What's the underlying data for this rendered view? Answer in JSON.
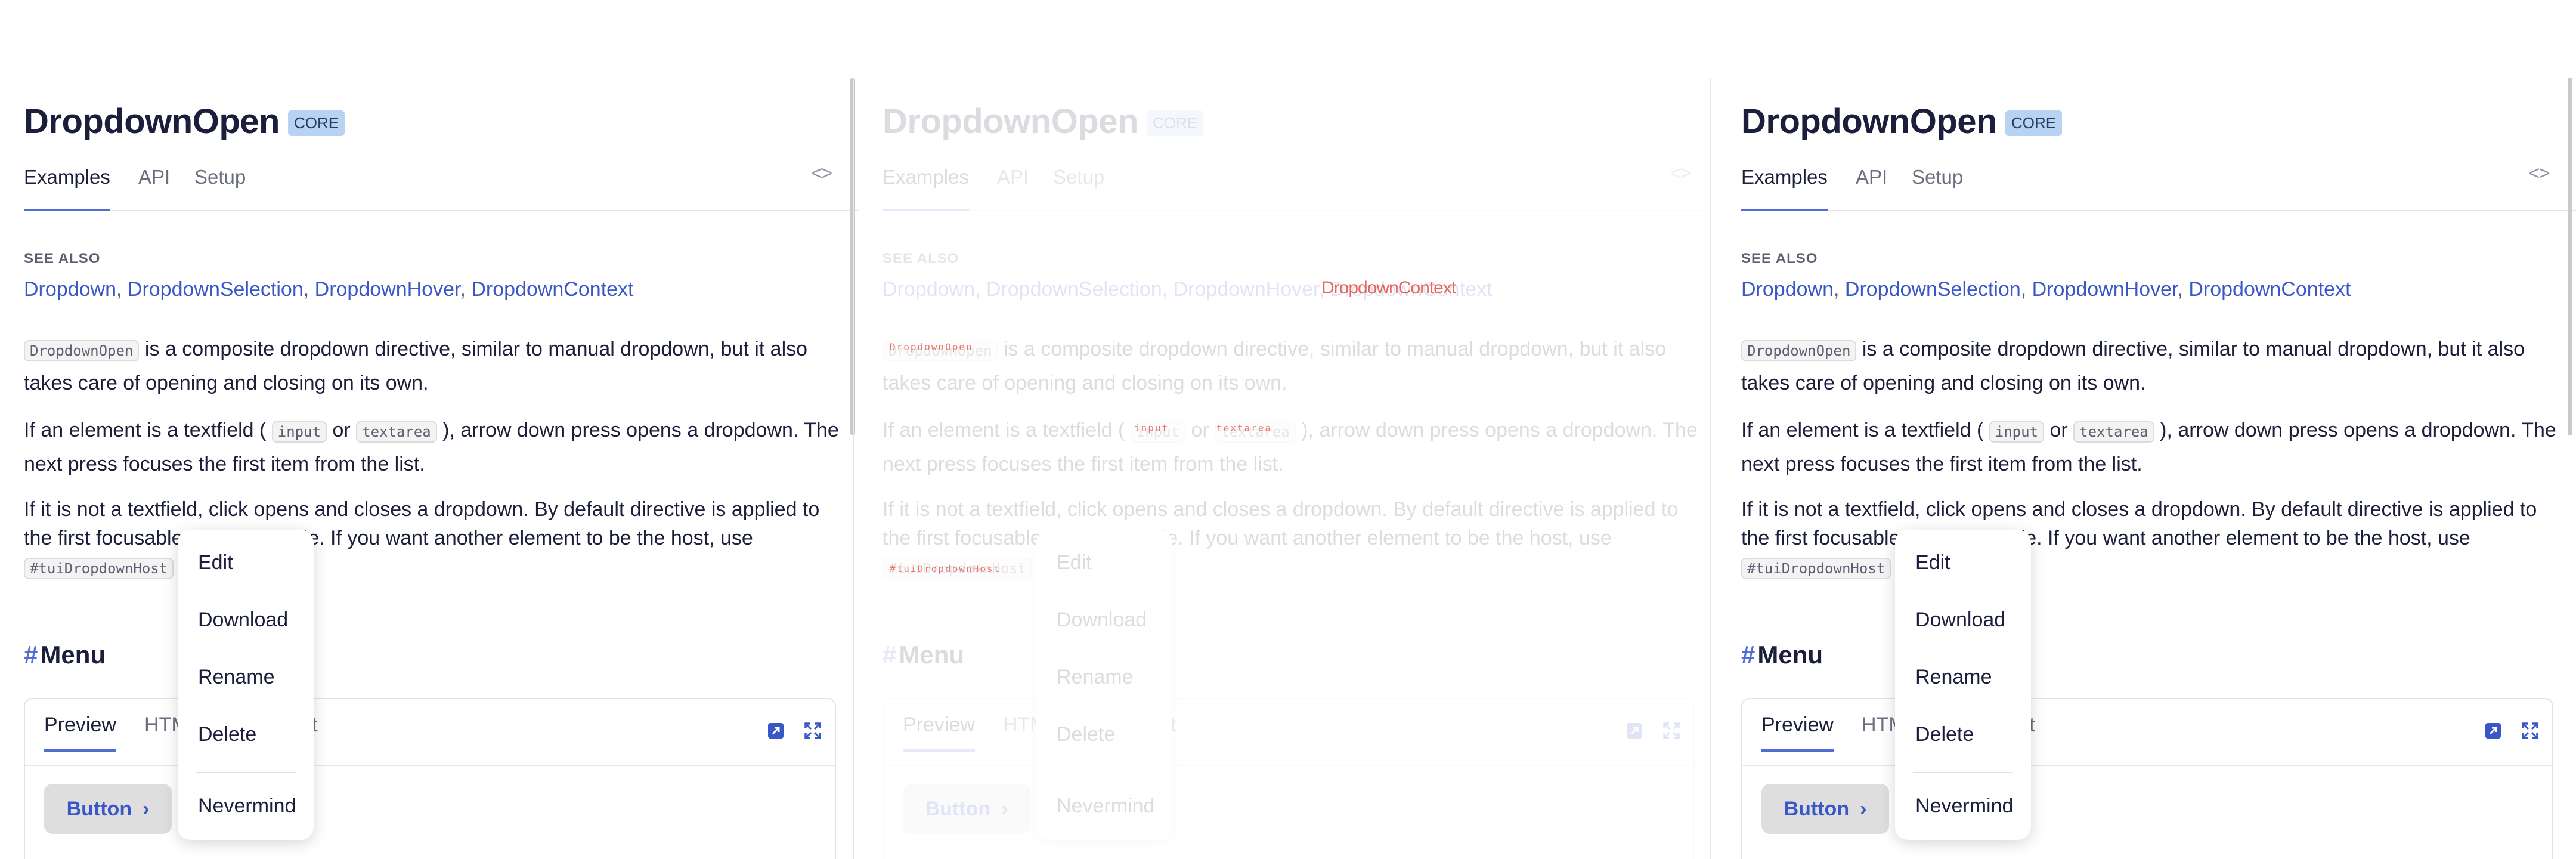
{
  "page": {
    "title": "DropdownOpen",
    "badge": "CORE",
    "tabs": [
      "Examples",
      "API",
      "Setup"
    ],
    "code_toggle": "<>"
  },
  "see_also": {
    "title": "SEE ALSO",
    "links": [
      "Dropdown",
      "DropdownSelection",
      "DropdownHover",
      "DropdownContext"
    ],
    "separator": ","
  },
  "paragraphs": {
    "p1_code": "DropdownOpen",
    "p1_text": " is a composite dropdown directive, similar to manual dropdown, but it also takes care of opening and closing on its own.",
    "p2_start": "If an element is a textfield ( ",
    "p2_code1": "input",
    "p2_or": " or ",
    "p2_code2": "textarea",
    "p2_end": " ), arrow down press opens a dropdown. The next press focuses the first item from the list.",
    "p3_text": "If it is not a textfield, click opens and closes a dropdown. By default directive is applied to the first focusable element inside. If you want another element to be the host, use",
    "p3_code": "#tuiDropdownHost"
  },
  "section": {
    "hash": "#",
    "title": "Menu"
  },
  "demo": {
    "tabs": [
      "Preview",
      "HTML",
      "TypeScript"
    ],
    "button_label": "Button",
    "chevron": "›"
  },
  "dropdown": {
    "items": [
      "Edit",
      "Download",
      "Rename",
      "Delete",
      "Nevermind"
    ]
  },
  "colors": {
    "accent": "#526ed3",
    "link": "#3a57c7",
    "badge_bg": "#b8d2f2"
  }
}
